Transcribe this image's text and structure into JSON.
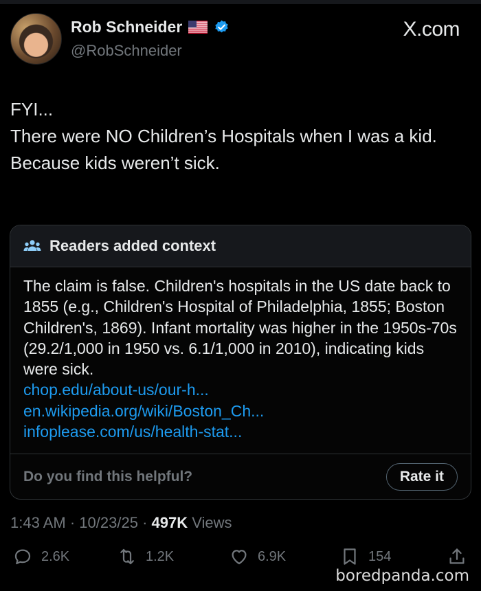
{
  "post": {
    "author_name": "Rob Schneider",
    "author_handle": "@RobSchneider",
    "source_label": "X.com",
    "text_lines": [
      "FYI...",
      "There were NO Children’s Hospitals when I was a kid.",
      "Because kids weren’t sick."
    ]
  },
  "community_note": {
    "title": "Readers added context",
    "body": "The claim is false. Children's hospitals in the US date back to 1855 (e.g., Children's Hospital of Philadelphia, 1855; Boston Children's, 1869). Infant mortality was higher in the 1950s-70s (29.2/1,000 in 1950 vs. 6.1/1,000 in 2010), indicating kids were sick.",
    "links": [
      "chop.edu/about-us/our-h...",
      "en.wikipedia.org/wiki/Boston_Ch...",
      "infoplease.com/us/health-stat..."
    ],
    "helpful_prompt": "Do you find this helpful?",
    "rate_label": "Rate it"
  },
  "meta": {
    "time": "1:43 AM",
    "date": "10/23/25",
    "views_count": "497K",
    "views_label": "Views",
    "separator": "·"
  },
  "actions": {
    "replies": "2.6K",
    "reposts": "1.2K",
    "likes": "6.9K",
    "bookmarks": "154"
  },
  "watermark": "boredpanda.com",
  "colors": {
    "background": "#000000",
    "text": "#e7e9ea",
    "muted": "#71767b",
    "link": "#1d9bf0",
    "verified": "#1d9bf0"
  }
}
